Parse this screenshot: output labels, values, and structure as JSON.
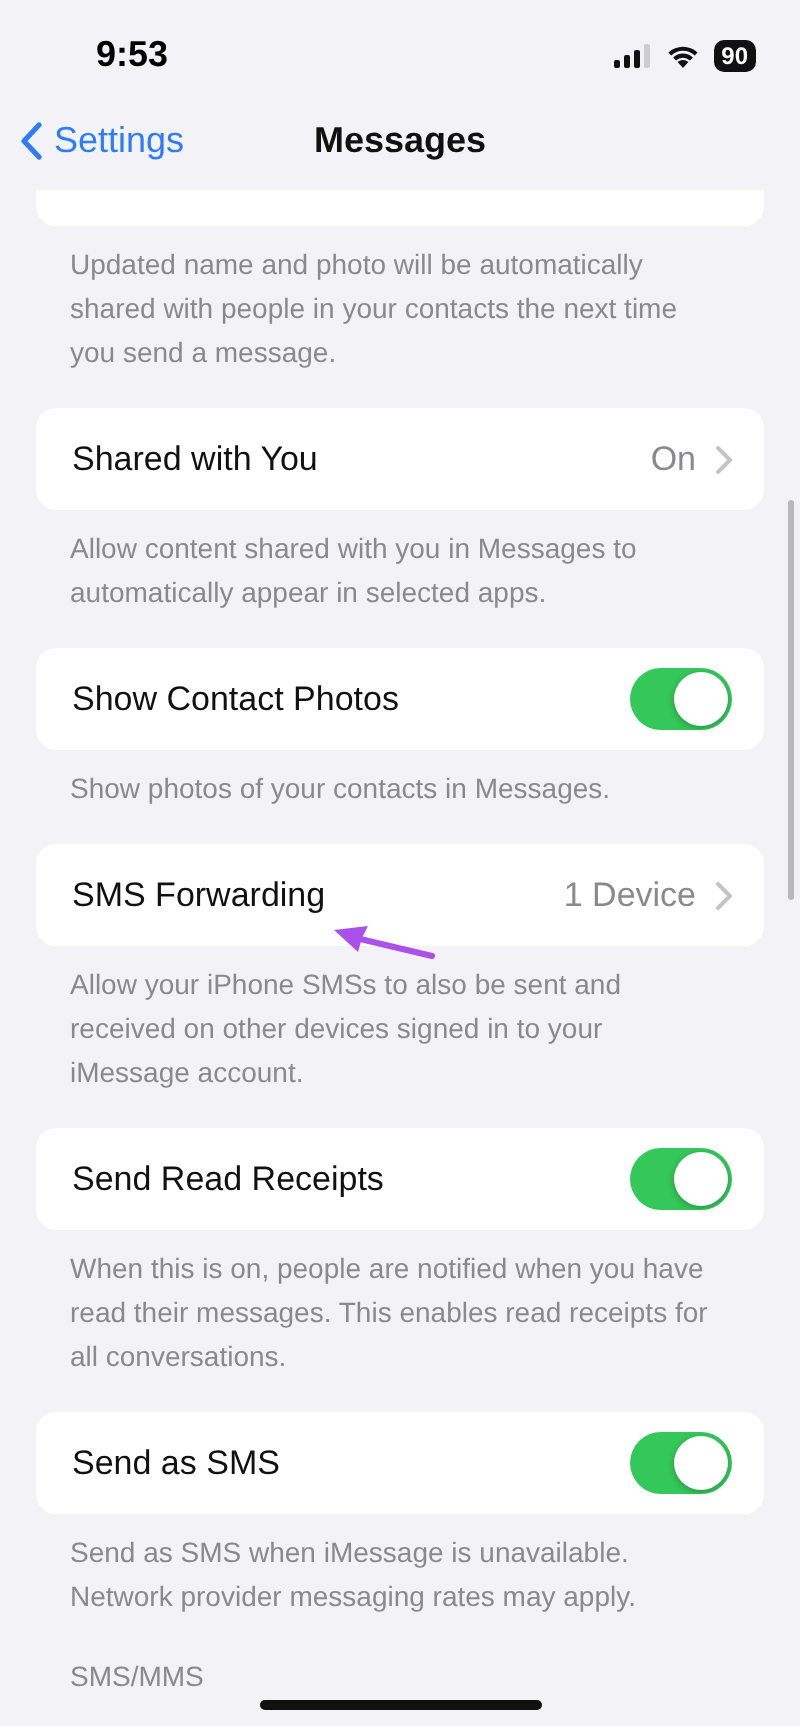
{
  "status_bar": {
    "time": "9:53",
    "battery": "90"
  },
  "nav": {
    "back": "Settings",
    "title": "Messages"
  },
  "sections": [
    {
      "kind": "partial",
      "description": "Updated name and photo will be automatically shared with people in your contacts the next time you send a message."
    },
    {
      "kind": "value",
      "label": "Shared with You",
      "value": "On",
      "description": "Allow content shared with you in Messages to automatically appear in selected apps."
    },
    {
      "kind": "toggle",
      "label": "Show Contact Photos",
      "on": true,
      "description": "Show photos of your contacts in Messages."
    },
    {
      "kind": "value",
      "label": "SMS Forwarding",
      "value": "1 Device",
      "description": "Allow your iPhone SMSs to also be sent and received on other devices signed in to your iMessage account."
    },
    {
      "kind": "toggle",
      "label": "Send Read Receipts",
      "on": true,
      "description": "When this is on, people are notified when you have read their messages. This enables read receipts for all conversations."
    },
    {
      "kind": "toggle",
      "label": "Send as SMS",
      "on": true,
      "description": "Send as SMS when iMessage is unavailable. Network provider messaging rates may apply."
    }
  ],
  "section_header": "SMS/MMS"
}
